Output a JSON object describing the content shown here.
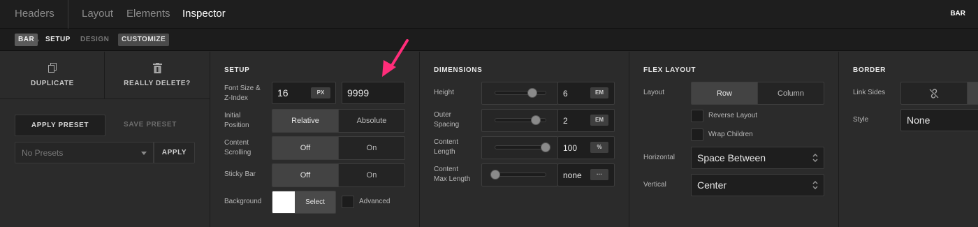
{
  "topbar": {
    "tab1": "Headers",
    "tab2": "Layout",
    "tab3": "Elements",
    "tab4": "Inspector",
    "right": "BAR"
  },
  "crumbs": {
    "c1": "BAR",
    "c2": "SETUP",
    "c3": "DESIGN",
    "c4": "CUSTOMIZE"
  },
  "actions": {
    "duplicate": "DUPLICATE",
    "delete": "REALLY DELETE?",
    "apply_preset": "APPLY PRESET",
    "save_preset": "SAVE PRESET",
    "presets": "No Presets",
    "apply": "APPLY"
  },
  "setup": {
    "title": "SETUP",
    "font_label": "Font Size &\nZ-Index",
    "font_size": "16",
    "font_unit": "PX",
    "zindex": "9999",
    "pos_label": "Initial\nPosition",
    "pos_opt1": "Relative",
    "pos_opt2": "Absolute",
    "scroll_label": "Content\nScrolling",
    "scroll_opt1": "Off",
    "scroll_opt2": "On",
    "sticky_label": "Sticky Bar",
    "sticky_opt1": "Off",
    "sticky_opt2": "On",
    "bg_label": "Background",
    "bg_select": "Select",
    "advanced": "Advanced"
  },
  "dimensions": {
    "title": "DIMENSIONS",
    "height_label": "Height",
    "height_val": "6",
    "height_unit": "EM",
    "height_level": 0.74,
    "outer_label": "Outer\nSpacing",
    "outer_val": "2",
    "outer_unit": "EM",
    "outer_level": 0.8,
    "len_label": "Content\nLength",
    "len_val": "100",
    "len_unit": "%",
    "len_level": 1.0,
    "max_label": "Content\nMax Length",
    "max_val": "none",
    "max_unit": "···",
    "max_level": 0.0
  },
  "flex": {
    "title": "FLEX LAYOUT",
    "layout_label": "Layout",
    "row": "Row",
    "column": "Column",
    "reverse": "Reverse Layout",
    "wrap": "Wrap Children",
    "horiz_label": "Horizontal",
    "horiz_val": "Space Between",
    "vert_label": "Vertical",
    "vert_val": "Center"
  },
  "border": {
    "title": "BORDER",
    "sides_label": "Link Sides",
    "style_label": "Style",
    "style_val": "None"
  },
  "colors": {
    "accent": "#ff2d7a"
  }
}
